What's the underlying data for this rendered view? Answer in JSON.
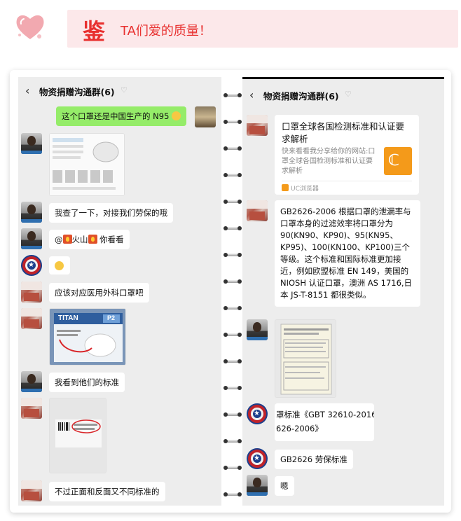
{
  "header": {
    "jian": "鉴",
    "subtitle": "TA们爱的质量！"
  },
  "left_chat": {
    "title": "物资捐赠沟通群(6)",
    "msg_n95": "这个口罩还是中国生产的 N95",
    "msg_checked": "我查了一下，对接我们劳保的哦",
    "msg_at_prefix": "@",
    "msg_at_name": "火山",
    "msg_at_suffix": "你看看",
    "msg_surgical": "应该对应医用外科口罩吧",
    "titan_brand": "TITAN",
    "titan_grade": "P2",
    "msg_standard": "我看到他们的标准",
    "msg_front_back": "不过正面和反面又不同标准的"
  },
  "right_chat": {
    "title": "物资捐赠沟通群(6)",
    "link_title": "口罩全球各国检测标准和认证要求解析",
    "link_desc": "快来看看我分享给你的网站:口罩全球各国检测标准和认证要求解析",
    "link_source": "UC浏览器",
    "msg_gb2626": "GB2626-2006 根据口罩的泄漏率与口罩本身的过滤效率将口罩分为 90(KN90、KP90)、95(KN95、KP95)、100(KN100、KP100)三个等级。这个标准和国际标准更加接近，例如欧盟标准 EN 149，美国的 NIOSH 认证口罩，澳洲 AS 1716,日本 JS-T-8151 都很类似。",
    "msg_gbt_line1": "罩标准《GBT 32610-2016》",
    "msg_gbt_line2": "626-2006》",
    "msg_gb_labor": "GB2626 劳保标准",
    "msg_en": "嗯"
  }
}
